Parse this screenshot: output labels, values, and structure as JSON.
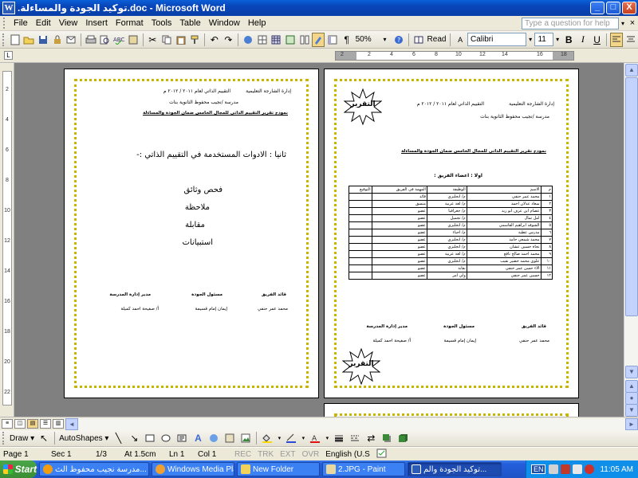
{
  "window": {
    "title": ".توكيد الجودة والمساءلة.doc - Microsoft Word",
    "app_icon": "W",
    "minimize": "_",
    "maximize": "□",
    "close": "X"
  },
  "menu": {
    "items": [
      "File",
      "Edit",
      "View",
      "Insert",
      "Format",
      "Tools",
      "Table",
      "Window",
      "Help"
    ],
    "ask_placeholder": "Type a question for help",
    "ask_dropdown": "▾",
    "doc_close": "×"
  },
  "toolbar": {
    "zoom": "50%",
    "read_label": "Read",
    "font": "Calibri",
    "font_size": "11",
    "bold": "B",
    "italic": "I",
    "underline": "U",
    "paragraph_mark": "¶"
  },
  "ruler": {
    "ticks": [
      "2",
      "2",
      "4",
      "6",
      "8",
      "10",
      "12",
      "14",
      "16",
      "18"
    ],
    "vticks": [
      "2",
      "4",
      "6",
      "8",
      "10",
      "12",
      "14",
      "16",
      "18",
      "20",
      "22"
    ]
  },
  "page_left": {
    "header_line1": "إدارة الشارجة التعليمية",
    "header_line1b": "التقييم الذاتي لعام ٢٠١١ / ٢٠١٢ م",
    "header_line2": "مدرسة /نجيب محفوظ الثانوية بنات",
    "form_title": "نموذج تقرير التقييم الذاتي للمجال الخامس ضمان الجودة والمساءلة",
    "section_title": "ثانيا : الادوات المستخدمة في التقييم الذاتي :-",
    "tools": [
      "فحص وثائق",
      "ملاحظة",
      "مقابلة",
      "استبيانات"
    ],
    "sig_titles": [
      "قائد الفريق",
      "مسئول الجودة",
      "مدير إدارة المدرسة"
    ],
    "sig_names": [
      "محمد عمر حنفي",
      "إيمان إمام قسيمة",
      "أ/ صفيحة احمد كميلة"
    ]
  },
  "page_right": {
    "header_line1": "إدارة الشارجة التعليمية",
    "header_line1b": "التقييم الذاتي لعام ٢٠١١ / ٢٠١٢ م",
    "header_line2": "مدرسة /نجيب محفوظ الثانوية بنات",
    "form_title": "نموذج تقرير التقييم الذاتي للمجال الخامس ضمان الجودة والمساءلة",
    "team_label": "اولا : اعضاء الفريق :",
    "starburst_label": "التقرير",
    "table_headers": [
      "م",
      "الاسم",
      "الوظيفة",
      "المهمة في الفريق",
      "التوقيع"
    ],
    "table_rows": [
      [
        "١",
        "محمد عمر حنفي",
        "م/ انجليزي",
        "قائد",
        ""
      ],
      [
        "٢",
        "سعاد عدلان احمد",
        "م/ لغة عربية",
        "منسق",
        ""
      ],
      [
        "٣",
        "عصام ابن عزف ابو زيد",
        "م/ جغرافيا",
        "عضو",
        ""
      ],
      [
        "٤",
        "امل تمال",
        "م/ تجميل",
        "عضو",
        ""
      ],
      [
        "٥",
        "الشوقه ابراهيم القاسمي",
        "م/ انجليزي",
        "عضو",
        ""
      ],
      [
        "٦",
        "مدرس عطية",
        "م/ احياء",
        "عضو",
        ""
      ],
      [
        "٧",
        "محمد شمعي حامد",
        "م/ انجليزي",
        "عضو",
        ""
      ],
      [
        "٨",
        "نجاة حسين عشان",
        "م/ انجليزي",
        "عضو",
        ""
      ],
      [
        "٩",
        "محمد احمد صالح نافع",
        "م/ لغة عربية",
        "عضو",
        ""
      ],
      [
        "١٠",
        "علوي محمد خضير نقيب",
        "م/ انجليزي",
        "عضو",
        ""
      ],
      [
        "١١",
        "الاء حسن عمر حنفي",
        "نقابة",
        "عضو",
        ""
      ],
      [
        "١٢",
        "حسين عمر حنفي",
        "ولي امر",
        "عضو",
        ""
      ]
    ],
    "sig_titles": [
      "قائد الفريق",
      "مسئول الجودة",
      "مدير إدارة المدرسة"
    ],
    "sig_names": [
      "محمد عمر حنفي",
      "إيمان إمام قسيمة",
      "أ/ صفيحة احمد كميلة"
    ]
  },
  "drawbar": {
    "draw": "Draw ▾",
    "autoshapes": "AutoShapes ▾"
  },
  "status": {
    "page": "Page  1",
    "sec": "Sec  1",
    "pages": "1/3",
    "at": "At  1.5cm",
    "ln": "Ln  1",
    "col": "Col  1",
    "rec": "REC",
    "trk": "TRK",
    "ext": "EXT",
    "ovr": "OVR",
    "lang": "English (U.S"
  },
  "taskbar": {
    "start": "Start",
    "tasks": [
      "مدرسة نجيب محفوظ الث...",
      "Windows Media Pla...",
      "New Folder",
      "2.JPG - Paint",
      "توكيد الجودة والم..."
    ],
    "lang_indicator": "EN",
    "clock": "11:05 AM"
  }
}
